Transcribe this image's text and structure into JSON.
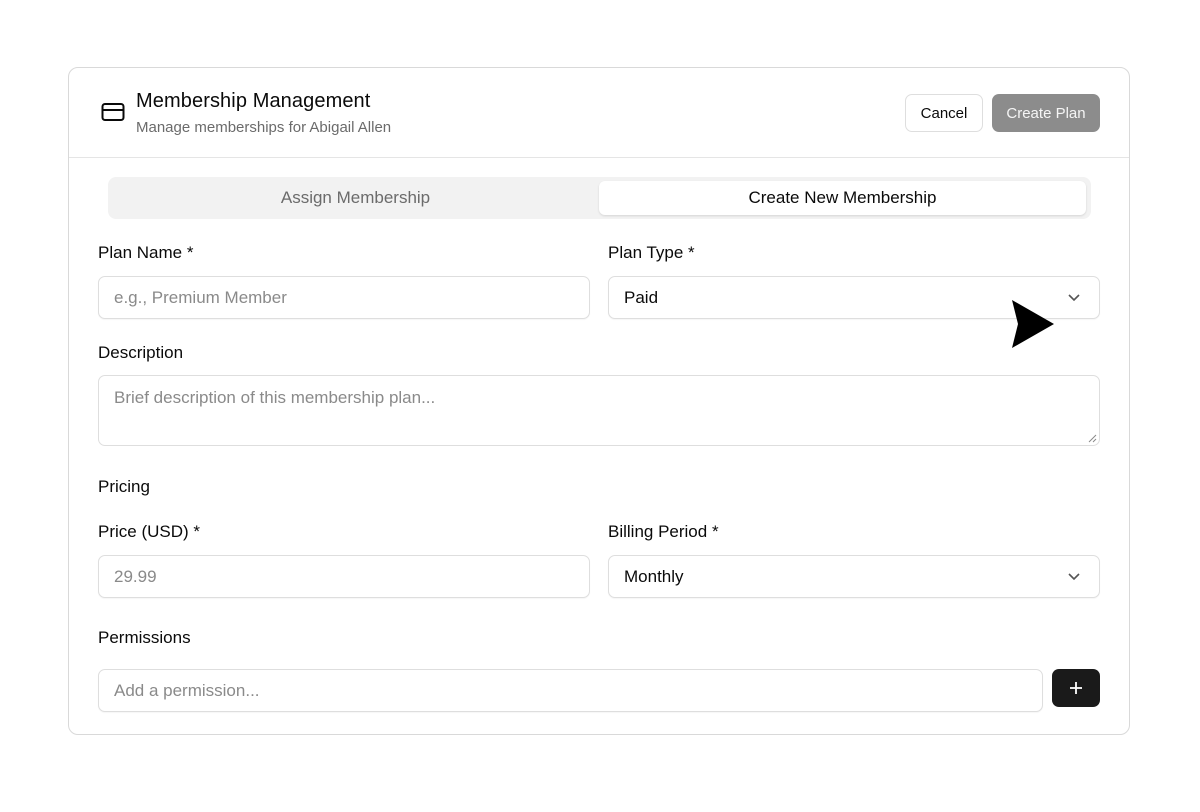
{
  "header": {
    "title": "Membership Management",
    "subtitle": "Manage memberships for Abigail Allen",
    "icon": "credit-card-icon",
    "cancel_label": "Cancel",
    "create_label": "Create Plan"
  },
  "tabs": [
    {
      "label": "Assign Membership",
      "active": false
    },
    {
      "label": "Create New Membership",
      "active": true
    }
  ],
  "form": {
    "plan_name": {
      "label": "Plan Name *",
      "placeholder": "e.g., Premium Member",
      "value": ""
    },
    "plan_type": {
      "label": "Plan Type *",
      "value": "Paid"
    },
    "description": {
      "label": "Description",
      "placeholder": "Brief description of this membership plan...",
      "value": ""
    },
    "pricing_section": "Pricing",
    "price": {
      "label": "Price (USD) *",
      "placeholder": "29.99",
      "value": ""
    },
    "billing_period": {
      "label": "Billing Period *",
      "value": "Monthly"
    },
    "permissions_section": "Permissions",
    "permission_input": {
      "placeholder": "Add a permission...",
      "value": ""
    }
  },
  "colors": {
    "primary_disabled": "#8c8c8c",
    "add_button": "#1a1a1a",
    "border": "#dedede",
    "muted_text": "#6b6b6b"
  }
}
